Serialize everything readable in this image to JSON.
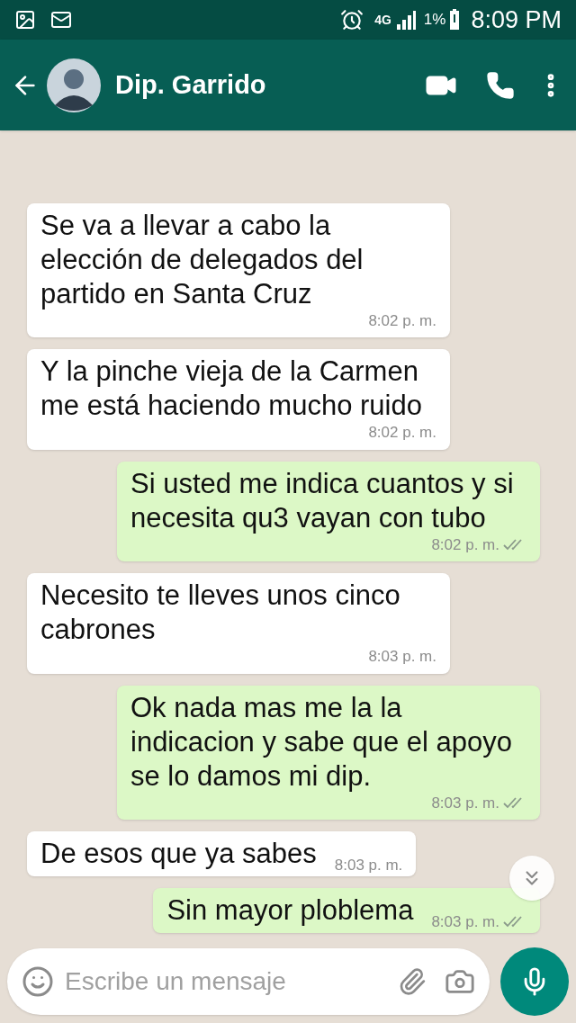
{
  "status_bar": {
    "network": "4G",
    "battery": "1%",
    "time": "8:09 PM"
  },
  "header": {
    "contact_name": "Dip. Garrido"
  },
  "messages": [
    {
      "kind": "in",
      "text": "Se va a llevar a cabo la elección de delegados del partido en Santa Cruz",
      "time": "8:02 p. m."
    },
    {
      "kind": "in",
      "text": "Y la pinche vieja de la Carmen me está haciendo mucho ruido",
      "time": "8:02 p. m."
    },
    {
      "kind": "out",
      "text": "Si usted me indica cuantos y si necesita qu3 vayan con tubo",
      "time": "8:02 p. m.",
      "delivered": true
    },
    {
      "kind": "in",
      "text": "Necesito te lleves unos cinco cabrones",
      "time": "8:03 p. m."
    },
    {
      "kind": "out",
      "text": "Ok nada mas me la la indicacion y sabe que el apoyo se lo damos mi dip.",
      "time": "8:03 p. m.",
      "delivered": true
    },
    {
      "kind": "in",
      "text": "De esos que ya sabes",
      "time": "8:03 p. m.",
      "inline_time": true
    },
    {
      "kind": "out",
      "text": "Sin mayor ploblema",
      "time": "8:03 p. m.",
      "delivered": true,
      "inline_time": true
    }
  ],
  "composer": {
    "placeholder": "Escribe un mensaje"
  }
}
